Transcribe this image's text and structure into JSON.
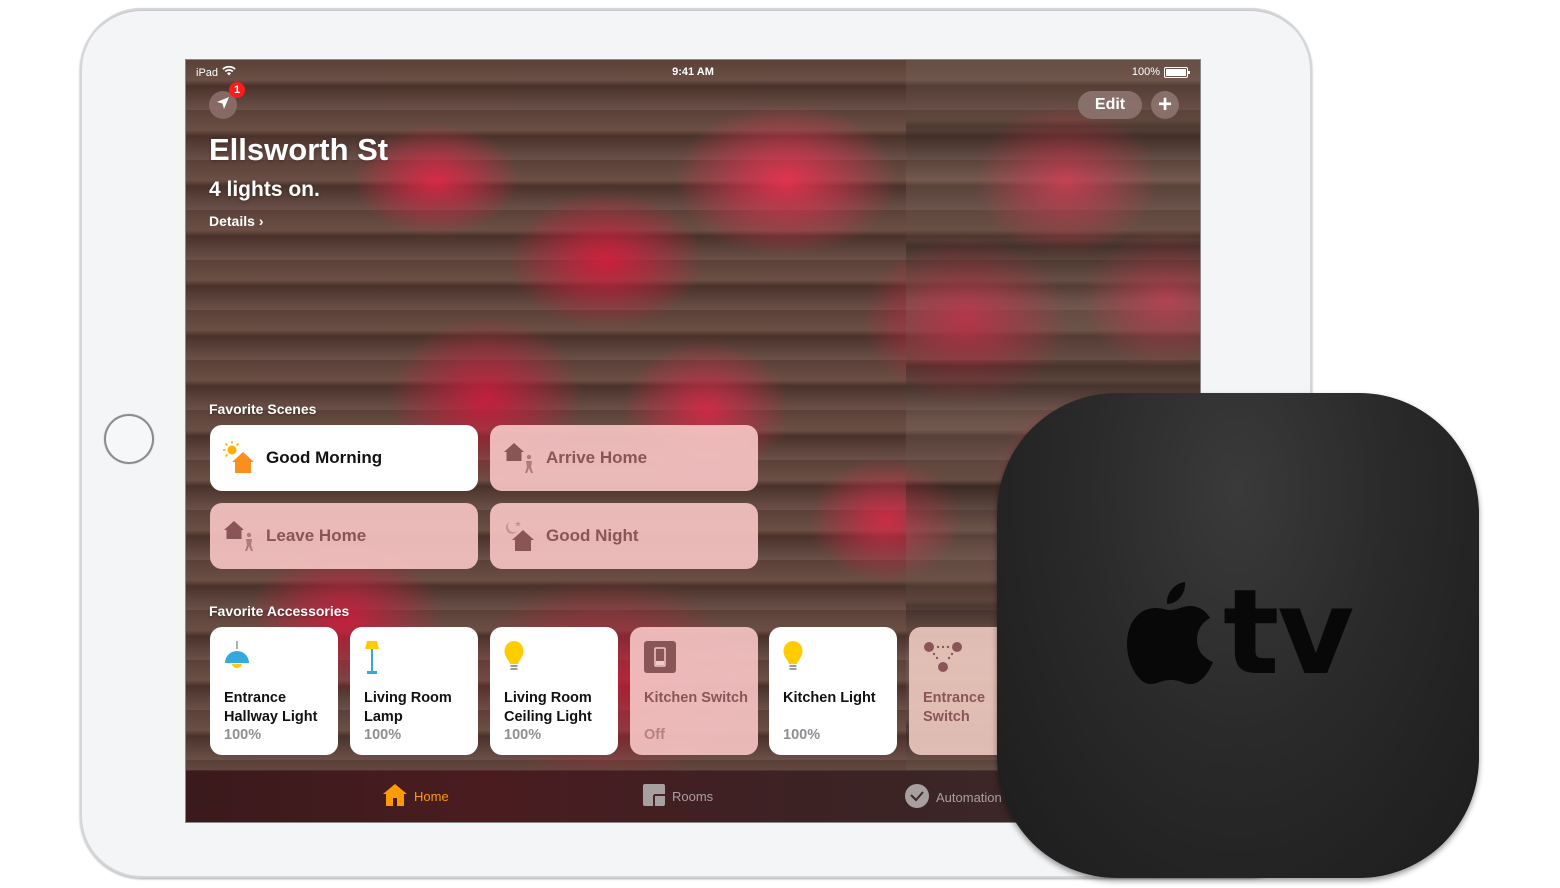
{
  "status_bar": {
    "device": "iPad",
    "time": "9:41 AM",
    "battery": "100%"
  },
  "header": {
    "location_badge": "1",
    "edit_label": "Edit",
    "add_label": "+",
    "home_name": "Ellsworth St",
    "summary": "4 lights on.",
    "details_label": "Details",
    "details_chevron": "›"
  },
  "scenes": {
    "section_label": "Favorite Scenes",
    "items": [
      {
        "label": "Good Morning",
        "icon": "sun-house-icon",
        "state": "on"
      },
      {
        "label": "Arrive Home",
        "icon": "house-person-icon",
        "state": "off"
      },
      {
        "label": "Leave Home",
        "icon": "house-person-icon",
        "state": "off"
      },
      {
        "label": "Good Night",
        "icon": "moon-house-icon",
        "state": "off"
      }
    ]
  },
  "accessories": {
    "section_label": "Favorite Accessories",
    "items": [
      {
        "name": "Entrance Hallway Light",
        "status": "100%",
        "icon": "pendant-light-icon",
        "state": "on"
      },
      {
        "name": "Living Room Lamp",
        "status": "100%",
        "icon": "floor-lamp-icon",
        "state": "on"
      },
      {
        "name": "Living Room Ceiling Light",
        "status": "100%",
        "icon": "bulb-icon",
        "state": "on"
      },
      {
        "name": "Kitchen Switch",
        "status": "Off",
        "icon": "switch-icon",
        "state": "off"
      },
      {
        "name": "Kitchen Light",
        "status": "100%",
        "icon": "bulb-icon",
        "state": "on"
      },
      {
        "name": "Entrance Switch",
        "status": "",
        "icon": "bridge-icon",
        "state": "off"
      }
    ]
  },
  "tab_bar": {
    "tabs": [
      {
        "label": "Home",
        "active": true
      },
      {
        "label": "Rooms",
        "active": false
      },
      {
        "label": "Automation",
        "active": false
      }
    ]
  },
  "apple_tv": {
    "logo_text": "tv"
  },
  "colors": {
    "accent_orange": "#ff9a05",
    "bulb_yellow": "#ffcc00",
    "lamp_blue": "#34aadc",
    "badge_red": "#fc1c1c"
  }
}
